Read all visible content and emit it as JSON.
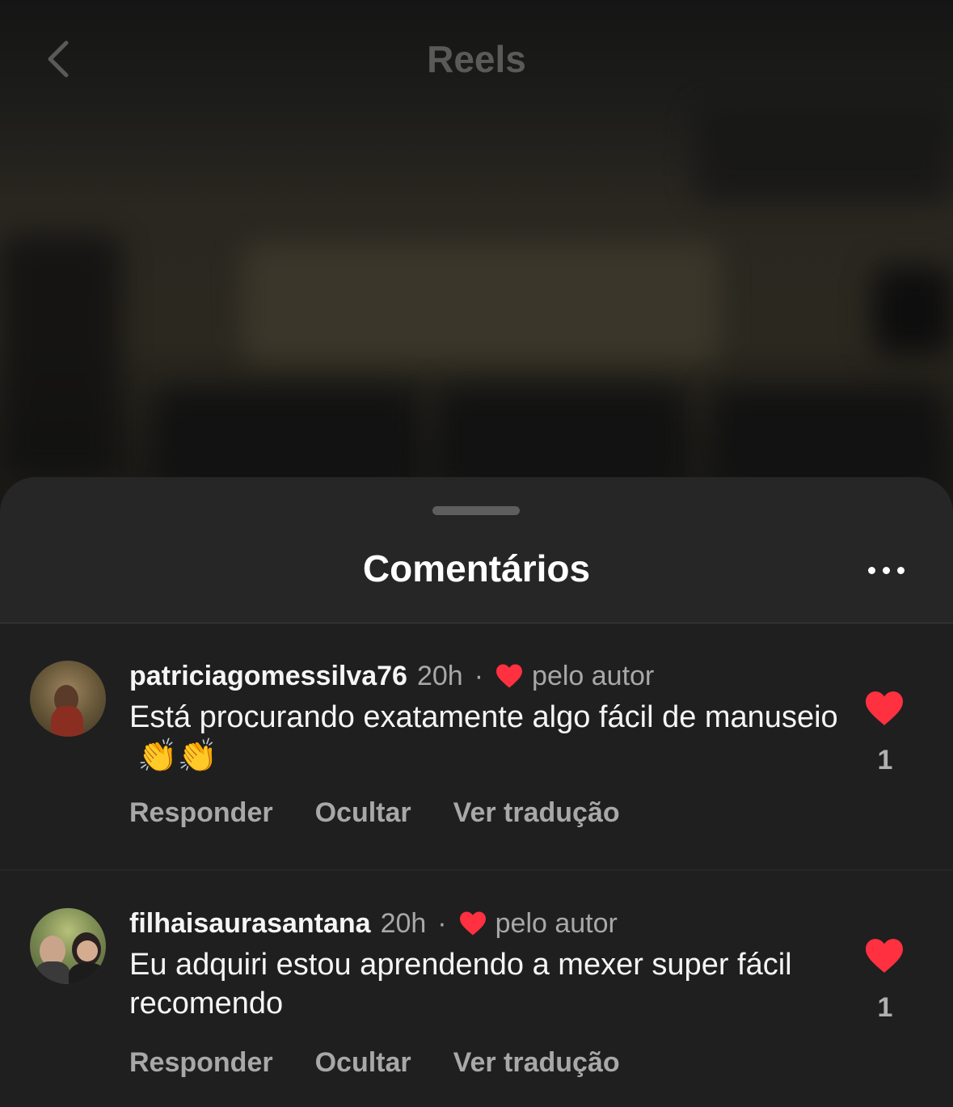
{
  "top_bar": {
    "title": "Reels"
  },
  "sheet": {
    "title": "Comentários"
  },
  "comments": [
    {
      "username": "patriciagomessilva76",
      "time": "20h",
      "separator": "·",
      "liked_by": "pelo autor",
      "text": "Está procurando exatamente algo fácil de manuseio",
      "emoji": "👏👏",
      "likes": "1",
      "actions": {
        "reply": "Responder",
        "hide": "Ocultar",
        "translate": "Ver tradução"
      }
    },
    {
      "username": "filhaisaurasantana",
      "time": "20h",
      "separator": "·",
      "liked_by": "pelo autor",
      "text": "Eu adquiri estou aprendendo a mexer super fácil recomendo",
      "likes": "1",
      "actions": {
        "reply": "Responder",
        "hide": "Ocultar",
        "translate": "Ver tradução"
      }
    }
  ],
  "colors": {
    "heart": "#ff3040",
    "sheet": "#262626",
    "secondary_text": "#a8a8a8"
  }
}
